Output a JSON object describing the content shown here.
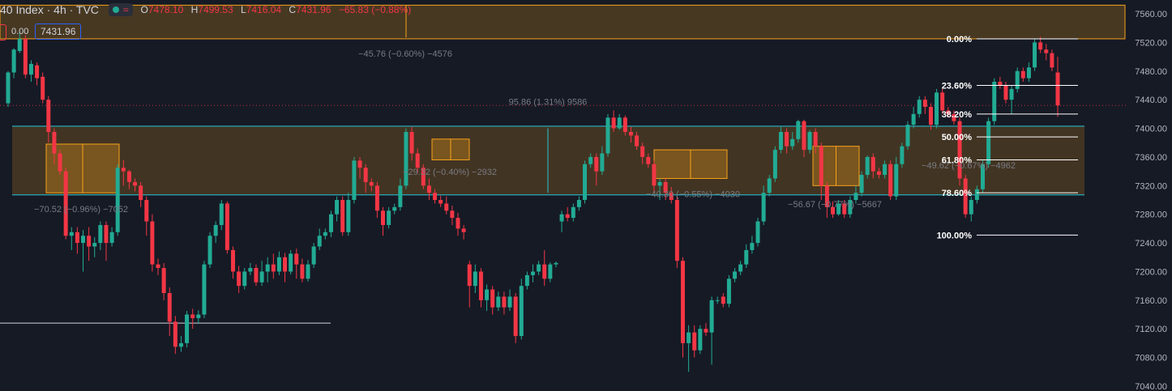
{
  "header": {
    "symbol": "40 Index · 4h · TVC",
    "open_label": "O",
    "open": "7478.10",
    "high_label": "H",
    "high": "7499.53",
    "low_label": "L",
    "low": "7416.04",
    "close_label": "C",
    "close": "7431.96",
    "change": "−65.83 (−0.88%)"
  },
  "left_badges": {
    "zero": "0.00",
    "price": "7431.96"
  },
  "colors": {
    "bg": "#161a25",
    "up": "#22ab94",
    "down": "#f23645",
    "zone": "#f7a21b",
    "cyan": "#26c6da",
    "text": "#d1d4dc",
    "muted": "#787b86"
  },
  "chart_data": {
    "type": "candlestick",
    "y_axis": {
      "min": 7040,
      "max": 7560,
      "ticks": [
        7560,
        7520,
        7480,
        7440,
        7400,
        7360,
        7320,
        7280,
        7240,
        7200,
        7160,
        7120,
        7080,
        7040
      ]
    },
    "last_price": 7431.96,
    "zones": [
      {
        "name": "top-zone",
        "from": 7525,
        "to": 7572
      },
      {
        "name": "range-zone",
        "from": 7307,
        "to": 7403
      }
    ],
    "fib": {
      "high": 7525,
      "low": 7251,
      "levels": [
        {
          "label": "0.00%",
          "price": 7525
        },
        {
          "label": "23.60%",
          "price": 7460
        },
        {
          "label": "38.20%",
          "price": 7420
        },
        {
          "label": "50.00%",
          "price": 7388
        },
        {
          "label": "61.80%",
          "price": 7356
        },
        {
          "label": "78.60%",
          "price": 7310
        },
        {
          "label": "100.00%",
          "price": 7251
        }
      ]
    },
    "measures": [
      {
        "text": "−45.76 (−0.60%) −4576",
        "value": -45.76
      },
      {
        "text": "95.86 (1.31%) 9586",
        "value": 95.86
      },
      {
        "text": "−70.52 (−0.96%) −7052",
        "value": -70.52
      },
      {
        "text": "−29.32 (−0.40%) −2932",
        "value": -29.32
      },
      {
        "text": "−40.30 (−0.55%) −4030",
        "value": -40.3
      },
      {
        "text": "−56.67 (−0.77%) −5667",
        "value": -56.67
      },
      {
        "text": "−49.62 (−0.67%) −4962",
        "value": -49.62
      }
    ],
    "candles": [
      [
        7435,
        7478,
        7430,
        7480
      ],
      [
        7478,
        7510,
        7470,
        7512
      ],
      [
        7508,
        7525,
        7505,
        7535
      ],
      [
        7525,
        7475,
        7470,
        7530
      ],
      [
        7475,
        7490,
        7465,
        7495
      ],
      [
        7488,
        7470,
        7460,
        7492
      ],
      [
        7472,
        7440,
        7435,
        7478
      ],
      [
        7440,
        7395,
        7380,
        7445
      ],
      [
        7395,
        7365,
        7350,
        7400
      ],
      [
        7365,
        7340,
        7335,
        7370
      ],
      [
        7340,
        7250,
        7245,
        7345
      ],
      [
        7250,
        7255,
        7230,
        7262
      ],
      [
        7255,
        7240,
        7225,
        7262
      ],
      [
        7240,
        7250,
        7200,
        7258
      ],
      [
        7250,
        7235,
        7215,
        7262
      ],
      [
        7235,
        7240,
        7220,
        7248
      ],
      [
        7240,
        7265,
        7230,
        7270
      ],
      [
        7265,
        7240,
        7215,
        7270
      ],
      [
        7240,
        7255,
        7235,
        7262
      ],
      [
        7255,
        7345,
        7250,
        7350
      ],
      [
        7345,
        7340,
        7320,
        7356
      ],
      [
        7340,
        7325,
        7315,
        7342
      ],
      [
        7325,
        7320,
        7312,
        7330
      ],
      [
        7320,
        7300,
        7290,
        7325
      ],
      [
        7300,
        7270,
        7250,
        7305
      ],
      [
        7270,
        7210,
        7200,
        7280
      ],
      [
        7210,
        7205,
        7195,
        7218
      ],
      [
        7205,
        7170,
        7160,
        7212
      ],
      [
        7170,
        7130,
        7110,
        7178
      ],
      [
        7130,
        7095,
        7085,
        7138
      ],
      [
        7095,
        7100,
        7088,
        7110
      ],
      [
        7100,
        7140,
        7094,
        7145
      ],
      [
        7140,
        7135,
        7120,
        7148
      ],
      [
        7135,
        7140,
        7128,
        7146
      ],
      [
        7140,
        7210,
        7135,
        7215
      ],
      [
        7210,
        7250,
        7205,
        7255
      ],
      [
        7250,
        7265,
        7240,
        7270
      ],
      [
        7265,
        7295,
        7258,
        7300
      ],
      [
        7295,
        7230,
        7225,
        7298
      ],
      [
        7230,
        7200,
        7190,
        7235
      ],
      [
        7200,
        7180,
        7170,
        7208
      ],
      [
        7180,
        7200,
        7175,
        7205
      ],
      [
        7200,
        7205,
        7195,
        7212
      ],
      [
        7205,
        7185,
        7180,
        7210
      ],
      [
        7185,
        7200,
        7180,
        7215
      ],
      [
        7200,
        7210,
        7185,
        7220
      ],
      [
        7210,
        7200,
        7190,
        7225
      ],
      [
        7200,
        7220,
        7195,
        7228
      ],
      [
        7220,
        7200,
        7185,
        7226
      ],
      [
        7200,
        7225,
        7196,
        7230
      ],
      [
        7225,
        7210,
        7190,
        7232
      ],
      [
        7210,
        7190,
        7185,
        7218
      ],
      [
        7190,
        7210,
        7186,
        7216
      ],
      [
        7210,
        7235,
        7205,
        7240
      ],
      [
        7235,
        7250,
        7230,
        7260
      ],
      [
        7250,
        7255,
        7245,
        7260
      ],
      [
        7255,
        7280,
        7248,
        7285
      ],
      [
        7280,
        7300,
        7270,
        7305
      ],
      [
        7300,
        7255,
        7250,
        7305
      ],
      [
        7255,
        7300,
        7250,
        7310
      ],
      [
        7300,
        7355,
        7295,
        7360
      ],
      [
        7355,
        7345,
        7330,
        7360
      ],
      [
        7345,
        7325,
        7310,
        7350
      ],
      [
        7325,
        7320,
        7312,
        7330
      ],
      [
        7320,
        7285,
        7275,
        7325
      ],
      [
        7285,
        7265,
        7250,
        7290
      ],
      [
        7265,
        7285,
        7260,
        7290
      ],
      [
        7285,
        7290,
        7280,
        7295
      ],
      [
        7290,
        7320,
        7285,
        7330
      ],
      [
        7320,
        7395,
        7315,
        7400
      ],
      [
        7395,
        7365,
        7355,
        7402
      ],
      [
        7365,
        7345,
        7338,
        7372
      ],
      [
        7345,
        7320,
        7315,
        7350
      ],
      [
        7320,
        7310,
        7300,
        7330
      ],
      [
        7310,
        7300,
        7295,
        7315
      ],
      [
        7300,
        7295,
        7290,
        7306
      ],
      [
        7295,
        7285,
        7280,
        7305
      ],
      [
        7285,
        7275,
        7265,
        7292
      ],
      [
        7275,
        7260,
        7250,
        7282
      ],
      [
        7260,
        7255,
        7245,
        7265
      ],
      [
        7210,
        7180,
        7150,
        7215
      ],
      [
        7180,
        7200,
        7170,
        7210
      ],
      [
        7200,
        7160,
        7150,
        7205
      ],
      [
        7160,
        7175,
        7145,
        7182
      ],
      [
        7175,
        7150,
        7140,
        7180
      ],
      [
        7150,
        7165,
        7145,
        7172
      ],
      [
        7165,
        7150,
        7140,
        7172
      ],
      [
        7150,
        7165,
        7145,
        7175
      ],
      [
        7165,
        7110,
        7100,
        7170
      ],
      [
        7110,
        7180,
        7105,
        7190
      ],
      [
        7180,
        7195,
        7175,
        7200
      ],
      [
        7195,
        7200,
        7185,
        7210
      ],
      [
        7200,
        7210,
        7195,
        7215
      ],
      [
        7210,
        7190,
        7180,
        7230
      ],
      [
        7190,
        7210,
        7185,
        7213
      ],
      [
        7210,
        7212,
        7206,
        7214
      ],
      [
        7270,
        7280,
        7255,
        7285
      ],
      [
        7280,
        7275,
        7270,
        7290
      ],
      [
        7275,
        7290,
        7270,
        7295
      ],
      [
        7290,
        7300,
        7285,
        7305
      ],
      [
        7300,
        7350,
        7295,
        7355
      ],
      [
        7350,
        7360,
        7345,
        7365
      ],
      [
        7360,
        7340,
        7320,
        7365
      ],
      [
        7340,
        7365,
        7335,
        7375
      ],
      [
        7365,
        7415,
        7360,
        7420
      ],
      [
        7415,
        7400,
        7395,
        7425
      ],
      [
        7400,
        7415,
        7398,
        7420
      ],
      [
        7415,
        7395,
        7390,
        7418
      ],
      [
        7395,
        7390,
        7380,
        7402
      ],
      [
        7390,
        7375,
        7370,
        7395
      ],
      [
        7375,
        7360,
        7350,
        7380
      ],
      [
        7360,
        7350,
        7345,
        7365
      ],
      [
        7350,
        7320,
        7310,
        7355
      ],
      [
        7320,
        7325,
        7300,
        7330
      ],
      [
        7325,
        7310,
        7300,
        7330
      ],
      [
        7310,
        7300,
        7295,
        7318
      ],
      [
        7300,
        7215,
        7205,
        7305
      ],
      [
        7215,
        7100,
        7080,
        7220
      ],
      [
        7100,
        7115,
        7060,
        7125
      ],
      [
        7115,
        7090,
        7080,
        7125
      ],
      [
        7090,
        7120,
        7085,
        7125
      ],
      [
        7120,
        7115,
        7110,
        7128
      ],
      [
        7115,
        7160,
        7070,
        7165
      ],
      [
        7160,
        7160,
        7155,
        7165
      ],
      [
        7165,
        7155,
        7150,
        7170
      ],
      [
        7155,
        7190,
        7150,
        7195
      ],
      [
        7190,
        7200,
        7185,
        7205
      ],
      [
        7200,
        7210,
        7195,
        7215
      ],
      [
        7210,
        7230,
        7205,
        7238
      ],
      [
        7230,
        7240,
        7225,
        7250
      ],
      [
        7240,
        7270,
        7235,
        7275
      ],
      [
        7270,
        7310,
        7265,
        7320
      ],
      [
        7310,
        7330,
        7305,
        7335
      ],
      [
        7330,
        7370,
        7325,
        7375
      ],
      [
        7370,
        7395,
        7365,
        7402
      ],
      [
        7395,
        7375,
        7365,
        7400
      ],
      [
        7375,
        7385,
        7370,
        7395
      ],
      [
        7385,
        7410,
        7380,
        7412
      ],
      [
        7410,
        7370,
        7360,
        7412
      ],
      [
        7370,
        7395,
        7365,
        7398
      ],
      [
        7395,
        7375,
        7365,
        7400
      ],
      [
        7375,
        7320,
        7300,
        7380
      ],
      [
        7320,
        7290,
        7275,
        7325
      ],
      [
        7290,
        7280,
        7275,
        7298
      ],
      [
        7280,
        7295,
        7278,
        7300
      ],
      [
        7295,
        7280,
        7275,
        7300
      ],
      [
        7280,
        7300,
        7275,
        7305
      ],
      [
        7300,
        7310,
        7295,
        7320
      ],
      [
        7310,
        7335,
        7305,
        7340
      ],
      [
        7335,
        7360,
        7330,
        7362
      ],
      [
        7360,
        7340,
        7330,
        7365
      ],
      [
        7340,
        7335,
        7330,
        7345
      ],
      [
        7335,
        7350,
        7330,
        7355
      ],
      [
        7350,
        7305,
        7300,
        7355
      ],
      [
        7305,
        7350,
        7300,
        7360
      ],
      [
        7350,
        7375,
        7345,
        7380
      ],
      [
        7375,
        7405,
        7370,
        7410
      ],
      [
        7405,
        7420,
        7400,
        7430
      ],
      [
        7420,
        7440,
        7415,
        7445
      ],
      [
        7440,
        7430,
        7420,
        7445
      ],
      [
        7430,
        7405,
        7398,
        7435
      ],
      [
        7405,
        7450,
        7400,
        7455
      ],
      [
        7450,
        7425,
        7420,
        7455
      ],
      [
        7425,
        7420,
        7415,
        7430
      ],
      [
        7420,
        7410,
        7405,
        7425
      ],
      [
        7410,
        7330,
        7320,
        7415
      ],
      [
        7330,
        7280,
        7275,
        7335
      ],
      [
        7280,
        7300,
        7270,
        7305
      ],
      [
        7300,
        7315,
        7295,
        7320
      ],
      [
        7315,
        7350,
        7310,
        7355
      ],
      [
        7350,
        7410,
        7345,
        7415
      ],
      [
        7410,
        7465,
        7405,
        7470
      ],
      [
        7465,
        7460,
        7455,
        7472
      ],
      [
        7460,
        7440,
        7435,
        7465
      ],
      [
        7440,
        7455,
        7420,
        7460
      ],
      [
        7455,
        7480,
        7450,
        7485
      ],
      [
        7480,
        7470,
        7465,
        7485
      ],
      [
        7470,
        7485,
        7465,
        7492
      ],
      [
        7485,
        7520,
        7480,
        7525
      ],
      [
        7520,
        7510,
        7505,
        7528
      ],
      [
        7510,
        7505,
        7495,
        7518
      ],
      [
        7505,
        7485,
        7480,
        7510
      ],
      [
        7478,
        7432,
        7416,
        7500
      ]
    ]
  }
}
